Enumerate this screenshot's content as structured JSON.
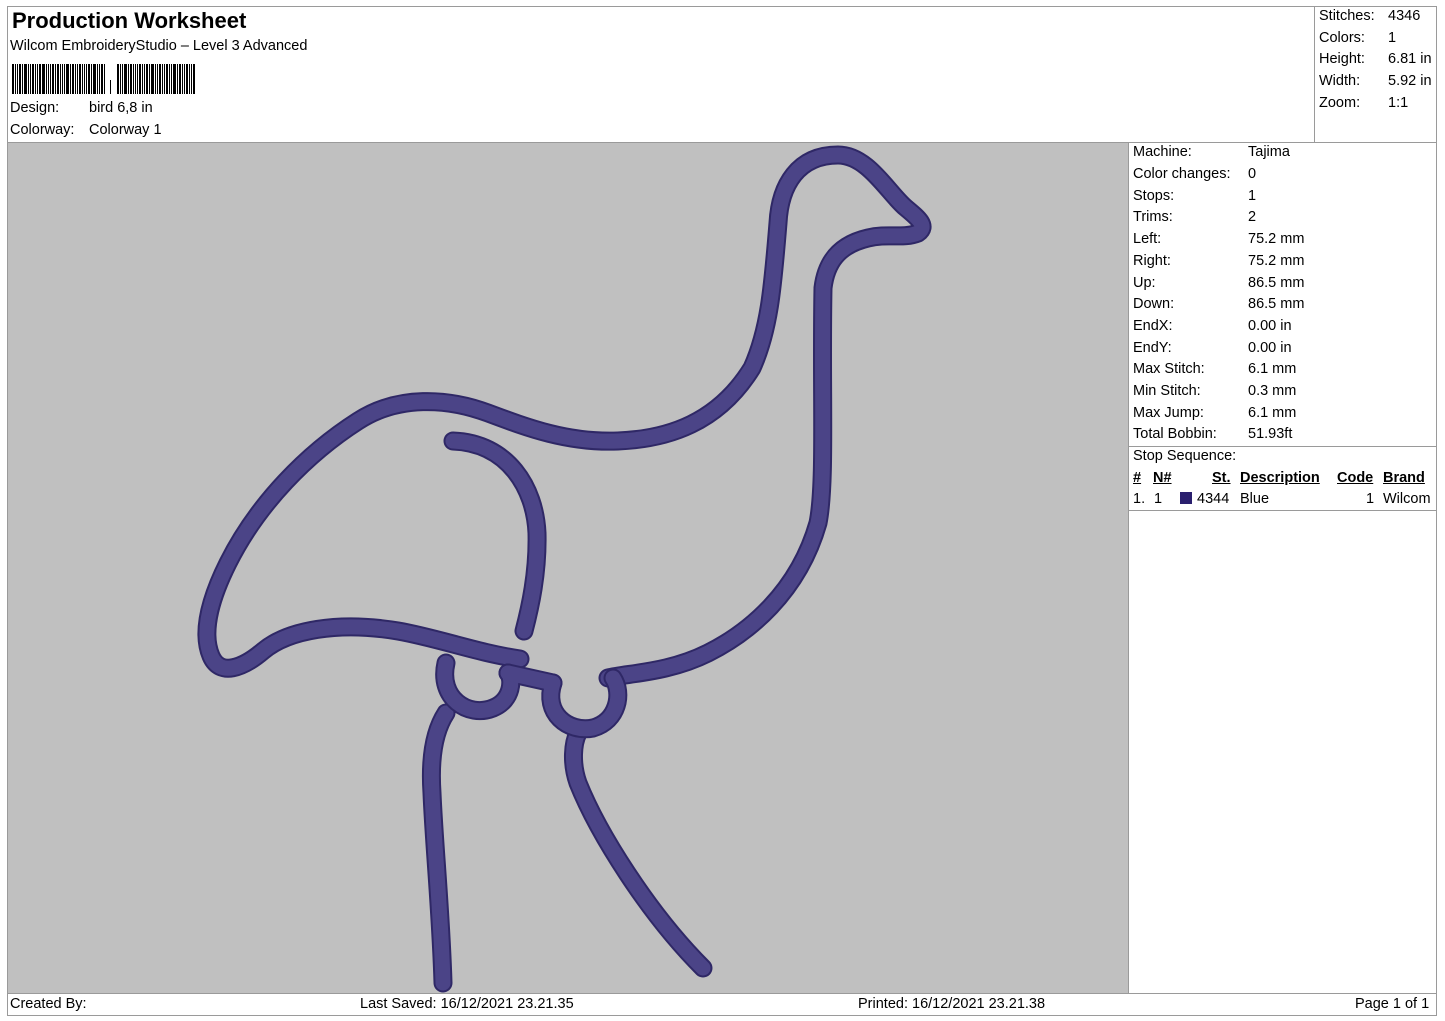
{
  "header": {
    "title": "Production Worksheet",
    "software": "Wilcom EmbroideryStudio – Level 3 Advanced",
    "design_label": "Design:",
    "design_value": "bird 6,8 in",
    "colorway_label": "Colorway:",
    "colorway_value": "Colorway 1"
  },
  "stats": [
    {
      "label": "Stitches:",
      "value": "4346"
    },
    {
      "label": "Colors:",
      "value": "1"
    },
    {
      "label": "Height:",
      "value": "6.81 in"
    },
    {
      "label": "Width:",
      "value": "5.92 in"
    },
    {
      "label": "Zoom:",
      "value": "1:1"
    }
  ],
  "machine_info": [
    {
      "label": "Machine:",
      "value": "Tajima"
    },
    {
      "label": "Color changes:",
      "value": "0"
    },
    {
      "label": "Stops:",
      "value": "1"
    },
    {
      "label": "Trims:",
      "value": "2"
    },
    {
      "label": "Left:",
      "value": "75.2 mm"
    },
    {
      "label": "Right:",
      "value": "75.2 mm"
    },
    {
      "label": "Up:",
      "value": "86.5 mm"
    },
    {
      "label": "Down:",
      "value": "86.5 mm"
    },
    {
      "label": "EndX:",
      "value": "0.00 in"
    },
    {
      "label": "EndY:",
      "value": "0.00 in"
    },
    {
      "label": "Max Stitch:",
      "value": "6.1 mm"
    },
    {
      "label": "Min Stitch:",
      "value": "0.3 mm"
    },
    {
      "label": "Max Jump:",
      "value": "6.1 mm"
    },
    {
      "label": "Total Bobbin:",
      "value": "51.93ft"
    }
  ],
  "stop_sequence": {
    "title": "Stop Sequence:",
    "columns": [
      "#",
      "N#",
      "St.",
      "Description",
      "Code",
      "Brand"
    ],
    "rows": [
      {
        "index": "1.",
        "n": "1",
        "color": "#2a1f6e",
        "st": "4344",
        "description": "Blue",
        "code": "1",
        "brand": "Wilcom"
      }
    ]
  },
  "design_preview": {
    "background": "#c0c0c0",
    "thread_color": "#4b4487",
    "thread_edge": "#2f2866"
  },
  "footer": {
    "created_by": "Created By:",
    "last_saved": "Last Saved: 16/12/2021 23.21.35",
    "printed": "Printed: 16/12/2021 23.21.38",
    "page": "Page 1 of 1"
  }
}
